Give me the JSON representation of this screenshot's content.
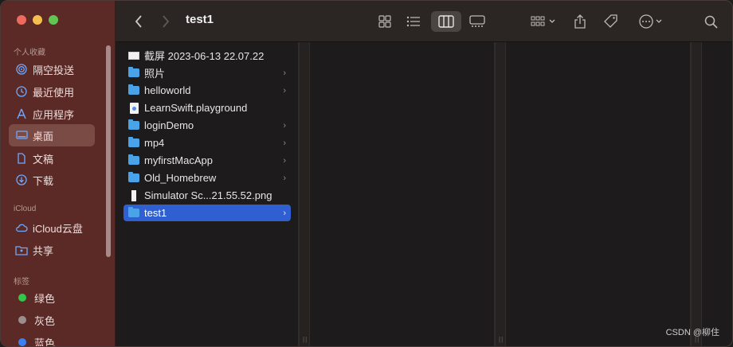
{
  "window": {
    "title": "test1"
  },
  "sidebar": {
    "favorites_title": "个人收藏",
    "favorites": [
      {
        "label": "隔空投送",
        "icon": "airdrop-icon"
      },
      {
        "label": "最近使用",
        "icon": "clock-icon"
      },
      {
        "label": "应用程序",
        "icon": "applications-icon"
      },
      {
        "label": "桌面",
        "icon": "desktop-icon",
        "active": true
      },
      {
        "label": "文稿",
        "icon": "document-icon"
      },
      {
        "label": "下载",
        "icon": "download-icon"
      }
    ],
    "icloud_title": "iCloud",
    "icloud": [
      {
        "label": "iCloud云盘",
        "icon": "cloud-icon"
      },
      {
        "label": "共享",
        "icon": "shared-folder-icon"
      }
    ],
    "tags_title": "标签",
    "tags": [
      {
        "label": "绿色",
        "color": "#32c64a"
      },
      {
        "label": "灰色",
        "color": "#9b8f8d"
      },
      {
        "label": "蓝色",
        "color": "#3a82f6"
      }
    ]
  },
  "files": [
    {
      "name": "截屏 2023-06-13 22.07.22",
      "type": "screenshot",
      "has_children": false
    },
    {
      "name": "照片",
      "type": "folder",
      "has_children": true
    },
    {
      "name": "helloworld",
      "type": "folder",
      "has_children": true
    },
    {
      "name": "LearnSwift.playground",
      "type": "swift",
      "has_children": false
    },
    {
      "name": "loginDemo",
      "type": "folder",
      "has_children": true
    },
    {
      "name": "mp4",
      "type": "folder",
      "has_children": true
    },
    {
      "name": "myfirstMacApp",
      "type": "folder",
      "has_children": true
    },
    {
      "name": "Old_Homebrew",
      "type": "folder",
      "has_children": true
    },
    {
      "name": "Simulator Sc...21.55.52.png",
      "type": "png",
      "has_children": false
    },
    {
      "name": "test1",
      "type": "folder",
      "has_children": true,
      "selected": true
    }
  ],
  "chevron": "›",
  "grip": "||",
  "watermark": "CSDN @柳住"
}
